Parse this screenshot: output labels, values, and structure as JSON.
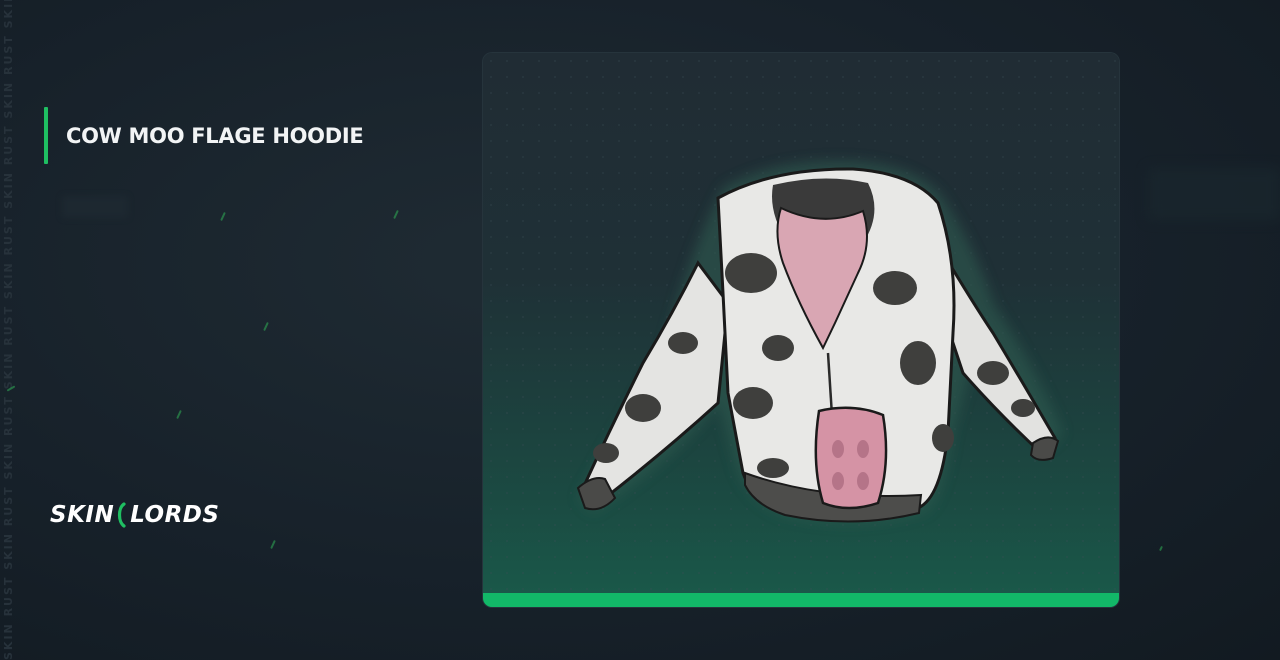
{
  "item": {
    "name": "COW MOO FLAGE HOODIE",
    "image_icon": "cow-pattern-hoodie-icon"
  },
  "brand": {
    "left": "SKIN",
    "right": "LORDS",
    "mark_icon": "bracket-mark-icon",
    "watermark": "SKIN RUST SKIN RUST SKIN RUST SKIN RUST SKIN RUST SKIN RUST SKIN RUST SKIN RUST"
  },
  "colors": {
    "accent": "#1fbf62",
    "background": "#17212a",
    "card_bottom_bar": "#12b868"
  }
}
